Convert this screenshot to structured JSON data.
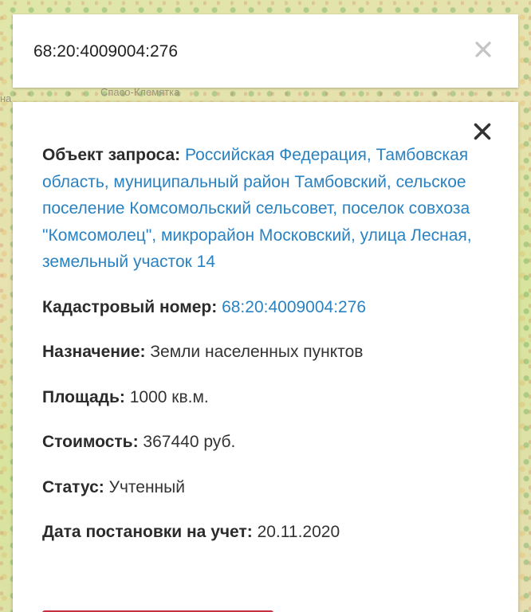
{
  "map": {
    "label_left": "на",
    "label_center": "Спасо-Клемятка"
  },
  "search": {
    "value": "68:20:4009004:276",
    "placeholder": ""
  },
  "card": {
    "request_object": {
      "label": "Объект запроса:",
      "value": "Российская Федерация, Тамбовская область, муниципальный район Тамбовский, сельское поселение Комсомольский сельсовет, поселок совхоза \"Комсомолец\", микрорайон Московский, улица Лесная, земельный участок 14"
    },
    "cadastral_number": {
      "label": "Кадастровый номер:",
      "value": "68:20:4009004:276"
    },
    "purpose": {
      "label": "Назначение:",
      "value": "Земли населенных пунктов"
    },
    "area": {
      "label": "Площадь:",
      "value": "1000 кв.м."
    },
    "cost": {
      "label": "Стоимость:",
      "value": "367440 руб."
    },
    "status": {
      "label": "Статус:",
      "value": "Учтенный"
    },
    "registration_date": {
      "label": "Дата постановки на учет:",
      "value": "20.11.2020"
    }
  },
  "colors": {
    "link": "#2a82c1",
    "accent_button": "#c8303f",
    "clear_icon": "#c4c4c4",
    "close_icon": "#333333"
  },
  "icons": {
    "search_clear": "close-icon",
    "card_close": "close-icon"
  }
}
